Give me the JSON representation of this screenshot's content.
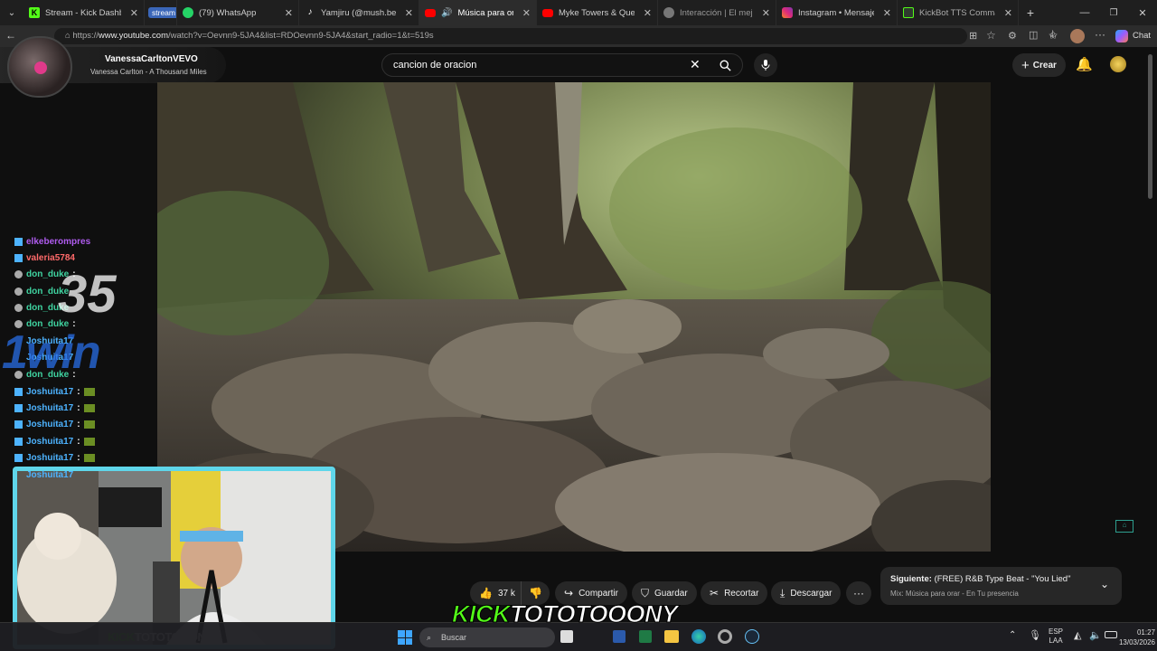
{
  "browser": {
    "tabs": [
      {
        "title": "Stream - Kick Dashboard",
        "icon": "kick-icon",
        "color": "#53fc18",
        "active": false
      },
      {
        "title": "stream",
        "icon": "tab-group-badge",
        "color": "#3a66b8",
        "active": false
      },
      {
        "title": "(79) WhatsApp",
        "icon": "whatsapp-icon",
        "color": "#25d366",
        "active": false
      },
      {
        "title": "Yamjiru (@mush.be.ll) |",
        "icon": "tiktok-icon",
        "color": "#ffffff",
        "active": false
      },
      {
        "title": "Música para orar - En",
        "icon": "youtube-icon",
        "color": "#ff0000",
        "active": true
      },
      {
        "title": "Myke Towers & Quevedo",
        "icon": "youtube-icon",
        "color": "#ff0000",
        "active": false
      },
      {
        "title": "Interacción | El mejor softw",
        "icon": "web-icon",
        "color": "#888888",
        "active": false
      },
      {
        "title": "Instagram • Mensajes",
        "icon": "instagram-icon",
        "color": "#e1306c",
        "active": false
      },
      {
        "title": "KickBot TTS Commands",
        "icon": "kickbot-icon",
        "color": "#2f3a2f",
        "active": false
      }
    ],
    "url_prefix": "https://",
    "url_host": "www.youtube.com",
    "url_path": "/watch?v=Oevnn9-5JA4&list=RDOevnn9-5JA4&start_radio=1&t=519s",
    "chat_button": "Chat"
  },
  "youtube": {
    "search_value": "cancion de oracion",
    "create_label": "Crear",
    "now_playing": {
      "channel": "VanessaCarltonVEVO",
      "song": "Vanessa Carlton - A Thousand Miles"
    },
    "actions": {
      "likes": "37 k",
      "share": "Compartir",
      "save": "Guardar",
      "clip": "Recortar",
      "download": "Descargar"
    },
    "next_up": {
      "prefix": "Siguiente:",
      "title": "(FREE) R&B Type Beat - \"You Lied\"",
      "subtitle": "Mix: Música para orar - En Tu presencia"
    }
  },
  "chat_overlay": {
    "rows": [
      {
        "user": "elkeberompres",
        "color": "#b05cf0"
      },
      {
        "user": "valeria5784",
        "color": "#ff6a6a"
      },
      {
        "user": "don_duke",
        "color": "#3fd3a0"
      },
      {
        "user": "don_duke",
        "color": "#3fd3a0"
      },
      {
        "user": "don_duke",
        "color": "#3fd3a0"
      },
      {
        "user": "don_duke",
        "color": "#3fd3a0"
      },
      {
        "user": "Joshuita17",
        "color": "#4db3ff"
      },
      {
        "user": "Joshuita17",
        "color": "#4db3ff"
      },
      {
        "user": "don_duke",
        "color": "#3fd3a0"
      },
      {
        "user": "Joshuita17",
        "color": "#4db3ff"
      },
      {
        "user": "Joshuita17",
        "color": "#4db3ff"
      },
      {
        "user": "Joshuita17",
        "color": "#4db3ff"
      },
      {
        "user": "Joshuita17",
        "color": "#4db3ff"
      },
      {
        "user": "Joshuita17",
        "color": "#4db3ff"
      },
      {
        "user": "Joshuita17",
        "color": "#4db3ff"
      }
    ],
    "promo_number": "35",
    "promo_brand": "1win"
  },
  "stream_branding": {
    "kick": "KICK",
    "name": "TOTOTOOONY"
  },
  "taskbar": {
    "search_placeholder": "Buscar",
    "lang_top": "ESP",
    "lang_bottom": "LAA",
    "time": "01:27",
    "date": "13/03/2026"
  },
  "colors": {
    "kick_green": "#53fc18",
    "cam_border": "#5fd6ea",
    "youtube_red": "#ff0000"
  }
}
